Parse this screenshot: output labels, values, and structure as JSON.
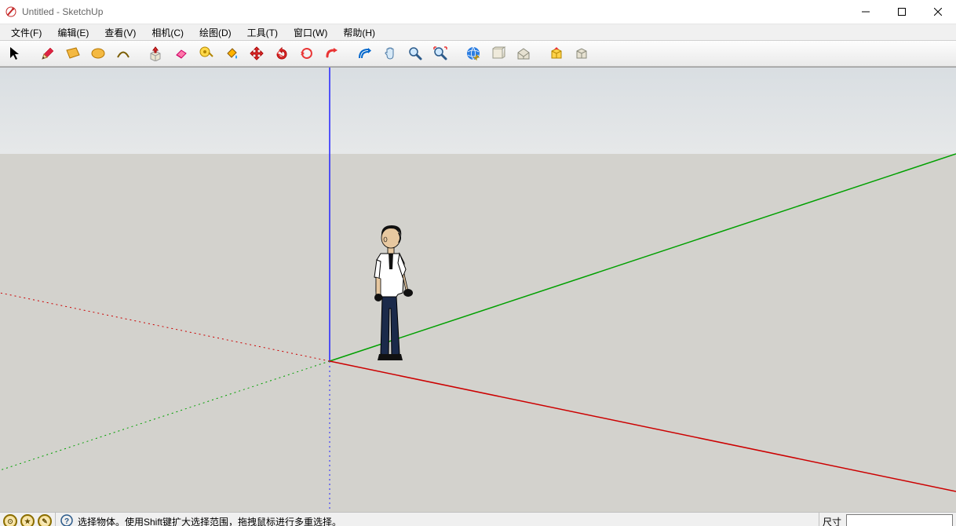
{
  "title": "Untitled - SketchUp",
  "menu": {
    "file": "文件(F)",
    "edit": "编辑(E)",
    "view": "查看(V)",
    "camera": "相机(C)",
    "draw": "绘图(D)",
    "tools": "工具(T)",
    "window": "窗口(W)",
    "help": "帮助(H)"
  },
  "toolbar_names": [
    "select",
    "pencil",
    "rectangle",
    "circle",
    "arc",
    "push-pull",
    "eraser",
    "tape-measure",
    "paint-bucket",
    "move",
    "compass",
    "rotate",
    "follow-me",
    "offset",
    "pan",
    "zoom",
    "zoom-extents",
    "previous-view",
    "model-info",
    "layers",
    "shadows",
    "warehouse",
    "extensions"
  ],
  "status": {
    "hint": "选择物体。使用Shift键扩大选择范围，拖拽鼠标进行多重选择。",
    "dim_label": "尺寸",
    "dim_value": ""
  }
}
